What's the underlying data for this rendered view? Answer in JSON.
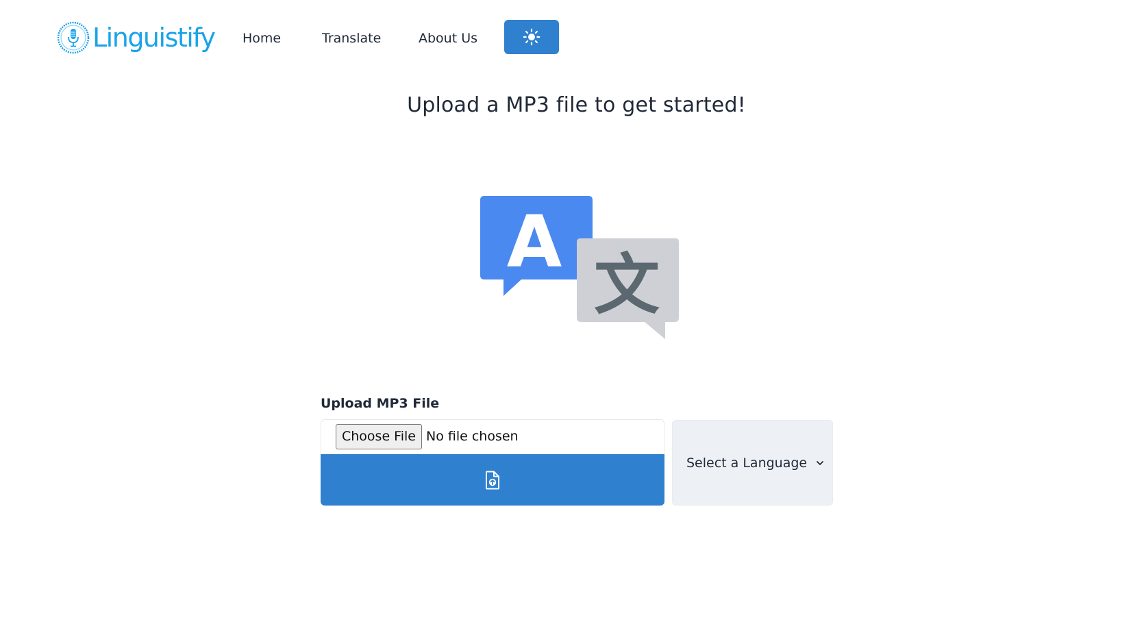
{
  "brand": {
    "name": "Linguistify",
    "color": "#1aa3ea"
  },
  "nav": {
    "items": [
      {
        "label": "Home"
      },
      {
        "label": "Translate"
      },
      {
        "label": "About Us"
      }
    ],
    "theme_toggle_icon": "sun-icon",
    "accent": "#2f80cf"
  },
  "main": {
    "title": "Upload a MP3 file to get started!",
    "hero_icon": "translate-icon",
    "hero_letters": {
      "latin": "A",
      "cjk": "文"
    },
    "hero_colors": {
      "blue_bubble": "#4a89ef",
      "gray_bubble": "#cfd0d5",
      "cjk_glyph": "#5c6870"
    }
  },
  "upload": {
    "label": "Upload MP3 File",
    "choose_file_label": "Choose File",
    "no_file_text": "No file chosen",
    "submit_icon": "file-upload-icon",
    "submit_color": "#2f80cf"
  },
  "language": {
    "selected_label": "Select a Language",
    "icon": "chevron-down-icon",
    "background": "#edf1f5"
  }
}
